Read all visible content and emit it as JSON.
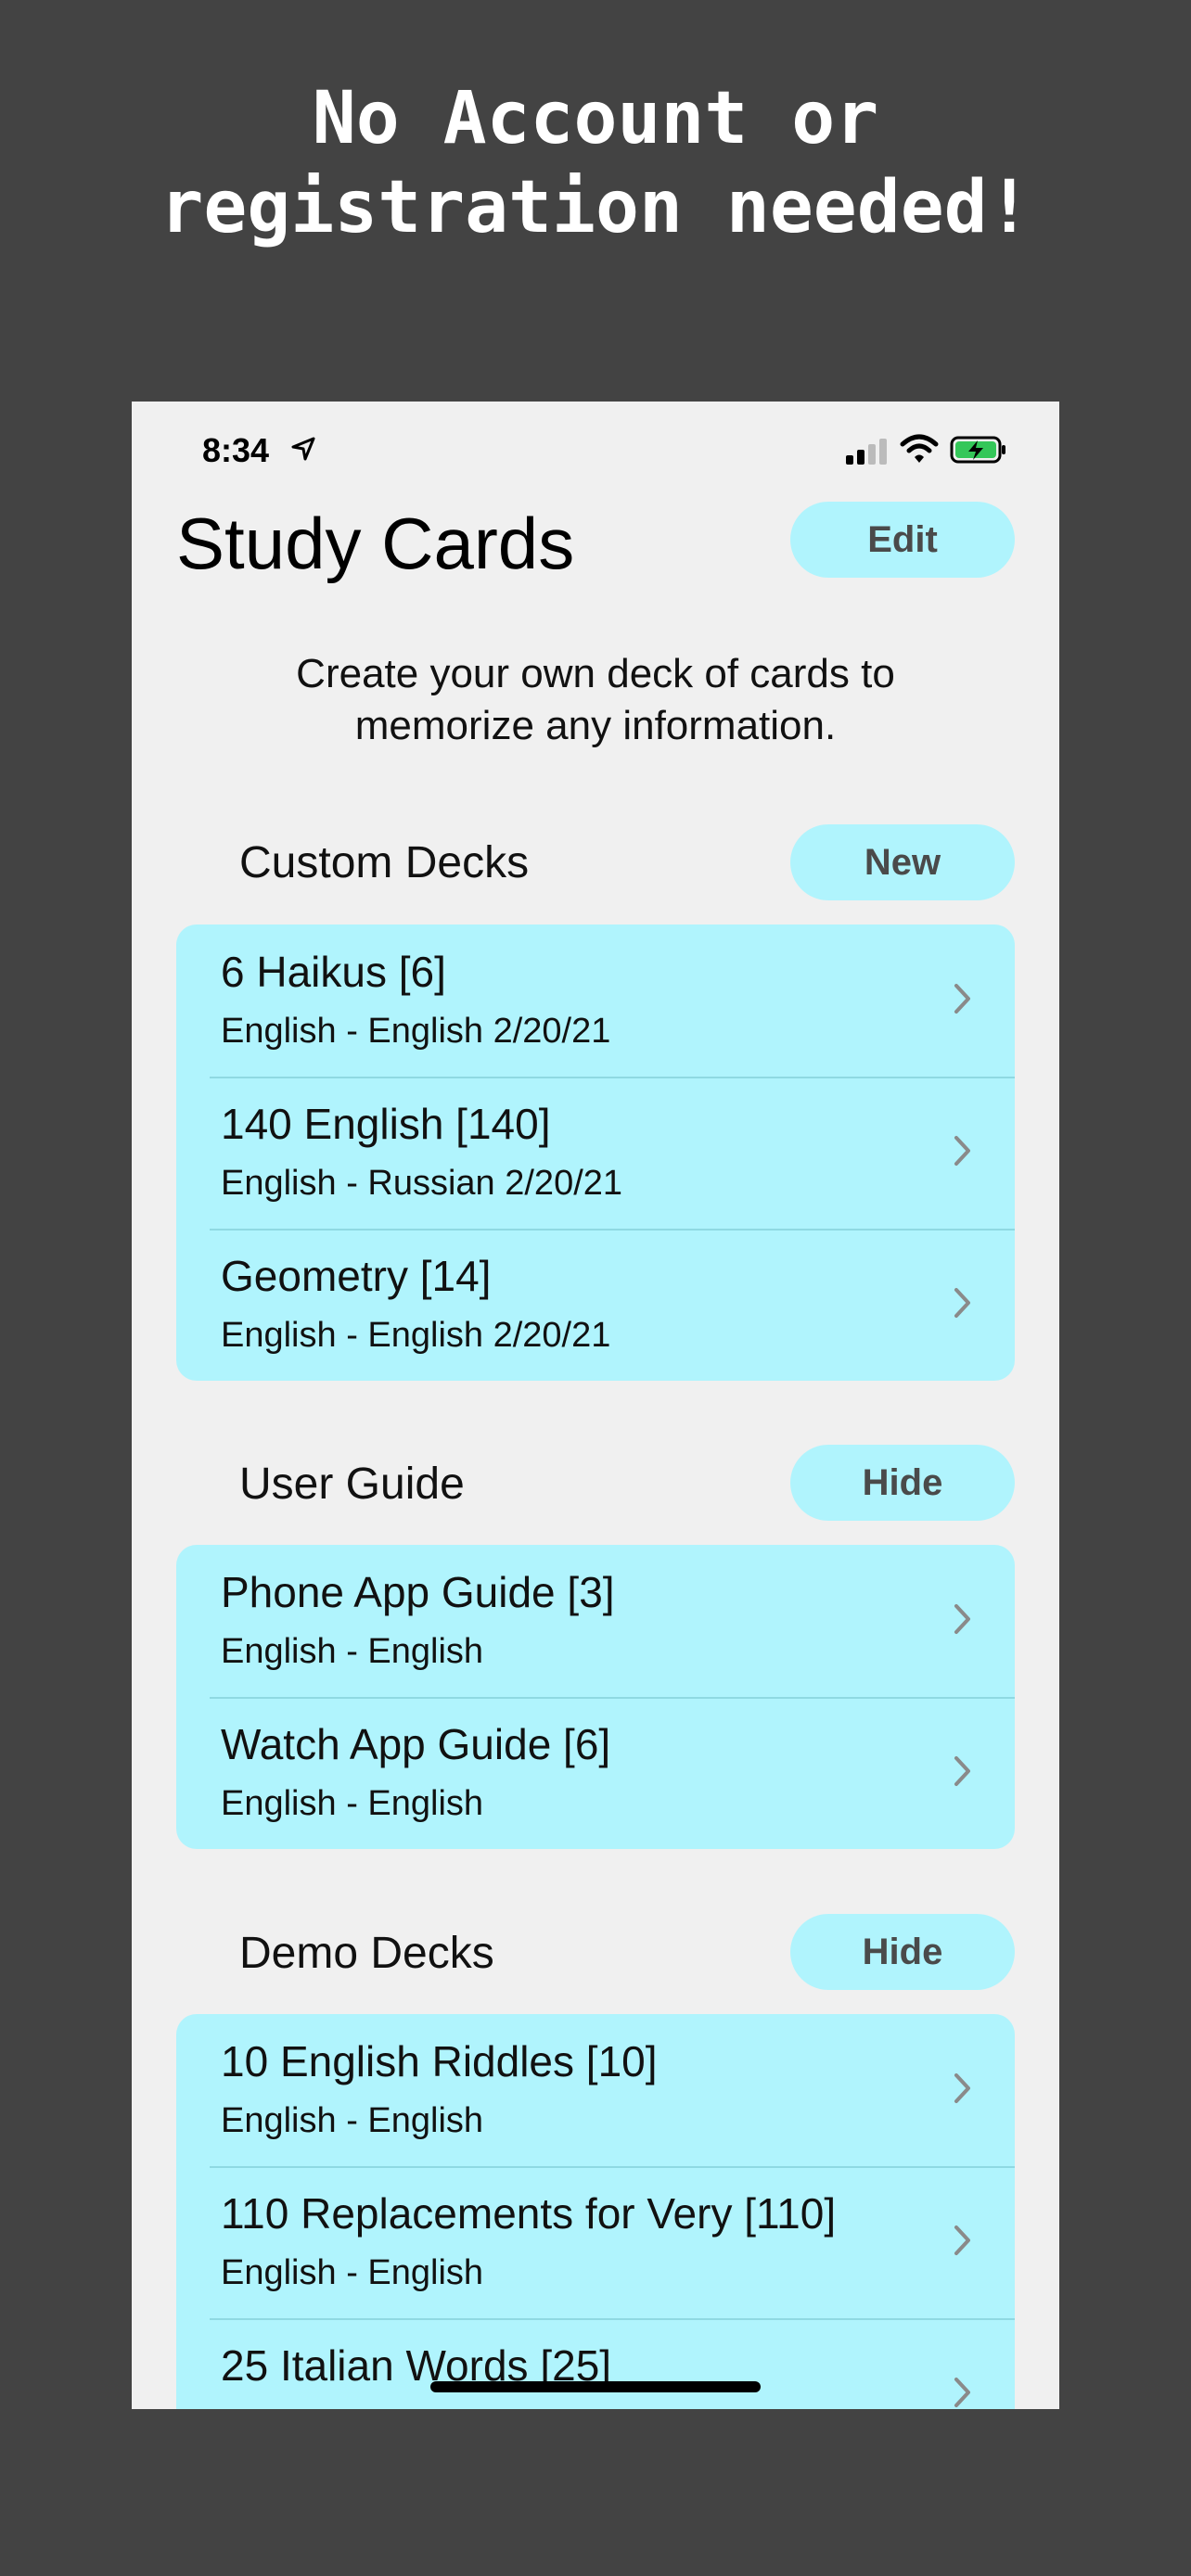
{
  "headline": {
    "line1": "No Account or",
    "line2": "registration needed!"
  },
  "status_bar": {
    "time": "8:34",
    "icons": [
      "location-arrow-icon",
      "signal-icon",
      "wifi-icon",
      "battery-charging-icon"
    ],
    "battery_color": "#34c759"
  },
  "header": {
    "title": "Study Cards",
    "edit_label": "Edit"
  },
  "subtitle": {
    "line1": "Create your own deck of cards to",
    "line2": "memorize any information."
  },
  "custom_decks": {
    "title": "Custom Decks",
    "button_label": "New",
    "items": [
      {
        "title": "6 Haikus [6]",
        "subtitle": "English - English 2/20/21"
      },
      {
        "title": "140 English [140]",
        "subtitle": "English - Russian 2/20/21"
      },
      {
        "title": "Geometry [14]",
        "subtitle": "English - English 2/20/21"
      }
    ]
  },
  "user_guide": {
    "title": "User Guide",
    "button_label": "Hide",
    "items": [
      {
        "title": "Phone App Guide [3]",
        "subtitle": "English - English"
      },
      {
        "title": "Watch App Guide [6]",
        "subtitle": "English - English"
      }
    ]
  },
  "demo_decks": {
    "title": "Demo Decks",
    "button_label": "Hide",
    "items": [
      {
        "title": "10 English Riddles [10]",
        "subtitle": "English - English"
      },
      {
        "title": "110 Replacements for Very [110]",
        "subtitle": "English - English"
      },
      {
        "title": "25 Italian Words [25]",
        "subtitle": ""
      }
    ]
  },
  "colors": {
    "background": "#434343",
    "screen": "#f0f0f0",
    "accent": "#b0f4fd",
    "button_text": "#4a4a4a"
  }
}
